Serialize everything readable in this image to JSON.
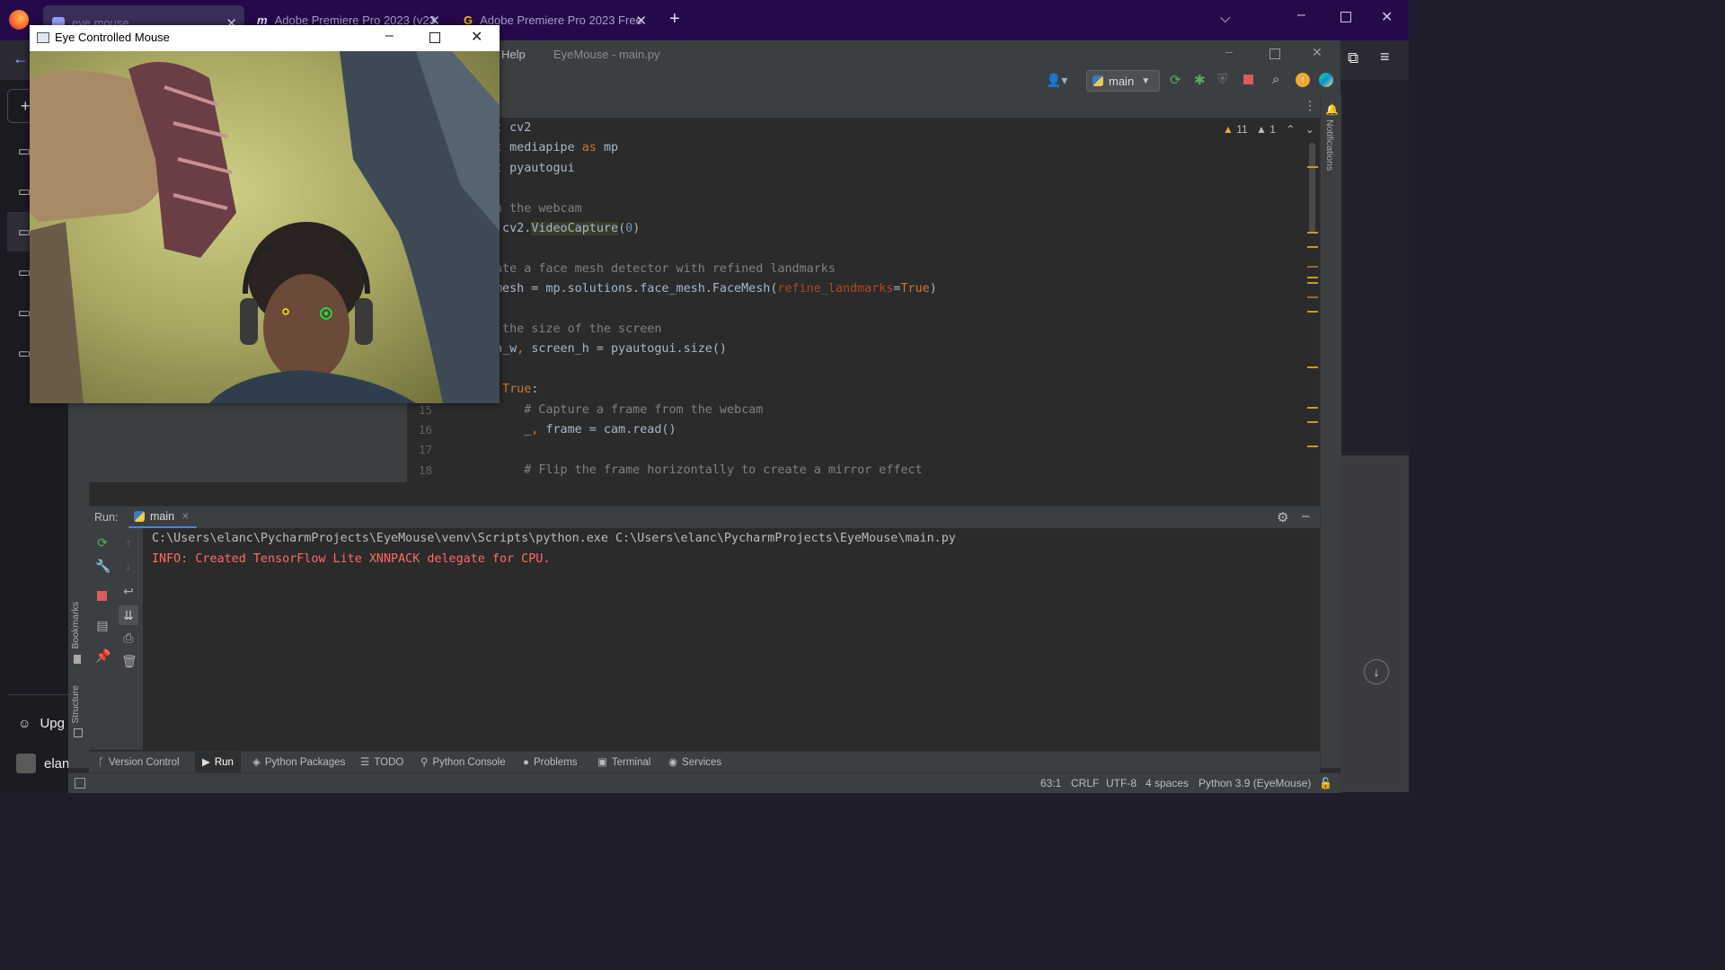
{
  "browser": {
    "tabs": [
      {
        "label": "eye mouse",
        "active": true
      },
      {
        "label": "Adobe Premiere Pro 2023 (v23",
        "active": false
      },
      {
        "label": "Adobe Premiere Pro 2023 Free",
        "active": false
      }
    ]
  },
  "sidebar": {
    "upgrade_label": "Upg",
    "user_label": "elan"
  },
  "pycharm": {
    "menu_help": "Help",
    "title": "EyeMouse - main.py",
    "run_config": "main",
    "inspections": {
      "warnings": "11",
      "weak_warnings": "1"
    },
    "notifications_label": "Notifications",
    "bookmarks_label": "Bookmarks",
    "structure_label": "Structure",
    "code_lines": [
      {
        "n": "",
        "segments": [
          {
            "t": "t ",
            "c": "kw"
          },
          {
            "t": "cv2",
            "c": ""
          }
        ]
      },
      {
        "n": "",
        "segments": [
          {
            "t": "t ",
            "c": "kw"
          },
          {
            "t": "mediapipe ",
            "c": ""
          },
          {
            "t": "as ",
            "c": "kw"
          },
          {
            "t": "mp",
            "c": ""
          }
        ]
      },
      {
        "n": "",
        "segments": [
          {
            "t": "t ",
            "c": "kw"
          },
          {
            "t": "pyautogui",
            "c": ""
          }
        ]
      },
      {
        "n": "",
        "segments": []
      },
      {
        "n": "",
        "segments": [
          {
            "t": "n the webcam",
            "c": "cm"
          }
        ]
      },
      {
        "n": "",
        "segments": [
          {
            "t": " cv2.",
            "c": ""
          },
          {
            "t": "VideoCapture",
            "c": "hl"
          },
          {
            "t": "(",
            "c": ""
          },
          {
            "t": "0",
            "c": "num"
          },
          {
            "t": ")",
            "c": ""
          }
        ]
      },
      {
        "n": "",
        "segments": []
      },
      {
        "n": "",
        "segments": [
          {
            "t": "ate a face mesh detector with refined landmarks",
            "c": "cm"
          }
        ]
      },
      {
        "n": "",
        "segments": [
          {
            "t": "mesh = mp.solutions.face_mesh.FaceMesh(",
            "c": ""
          },
          {
            "t": "refine_landmarks",
            "c": "param"
          },
          {
            "t": "=",
            "c": ""
          },
          {
            "t": "True",
            "c": "kw"
          },
          {
            "t": ")",
            "c": ""
          }
        ]
      },
      {
        "n": "",
        "segments": []
      },
      {
        "n": "",
        "segments": [
          {
            "t": " the size of the screen",
            "c": "cm"
          }
        ]
      },
      {
        "n": "",
        "segments": [
          {
            "t": "n_w",
            "c": ""
          },
          {
            "t": ", ",
            "c": "kw"
          },
          {
            "t": "screen_h = pyautogui.size()",
            "c": ""
          }
        ]
      },
      {
        "n": "",
        "segments": []
      },
      {
        "n": "",
        "segments": [
          {
            "t": " True",
            "c": "kw"
          },
          {
            "t": ":",
            "c": ""
          }
        ]
      },
      {
        "n": "15",
        "segments": [
          {
            "t": "    ",
            "c": ""
          },
          {
            "t": "# Capture a frame from the webcam",
            "c": "cm"
          }
        ]
      },
      {
        "n": "16",
        "segments": [
          {
            "t": "    _",
            "c": ""
          },
          {
            "t": ", ",
            "c": "kw"
          },
          {
            "t": "frame = cam.read()",
            "c": ""
          }
        ]
      },
      {
        "n": "17",
        "segments": []
      },
      {
        "n": "18",
        "segments": [
          {
            "t": "    ",
            "c": ""
          },
          {
            "t": "# Flip the frame horizontally to create a mirror effect",
            "c": "cm"
          }
        ]
      }
    ],
    "run": {
      "label": "Run:",
      "tab": "main",
      "console_lines": [
        {
          "text": "C:\\Users\\elanc\\PycharmProjects\\EyeMouse\\venv\\Scripts\\python.exe C:\\Users\\elanc\\PycharmProjects\\EyeMouse\\main.py",
          "color": "#bbbbbb"
        },
        {
          "text": "INFO: Created TensorFlow Lite XNNPACK delegate for CPU.",
          "color": "#ff6b68"
        }
      ]
    },
    "bottom_tabs": [
      {
        "label": "Version Control",
        "icon": "branch-icon"
      },
      {
        "label": "Run",
        "icon": "play-icon"
      },
      {
        "label": "Python Packages",
        "icon": "layers-icon"
      },
      {
        "label": "TODO",
        "icon": "list-icon"
      },
      {
        "label": "Python Console",
        "icon": "python-icon"
      },
      {
        "label": "Problems",
        "icon": "info-icon"
      },
      {
        "label": "Terminal",
        "icon": "terminal-icon"
      },
      {
        "label": "Services",
        "icon": "services-icon"
      }
    ],
    "status": {
      "position": "63:1",
      "line_ending": "CRLF",
      "encoding": "UTF-8",
      "indent": "4 spaces",
      "interpreter": "Python 3.9 (EyeMouse)"
    }
  },
  "cam_window": {
    "title": "Eye Controlled Mouse"
  },
  "colors": {
    "accent_red": "#ff6b68",
    "keyword": "#cc7832",
    "comment": "#808080",
    "browser_tabbar": "#250a4a"
  }
}
